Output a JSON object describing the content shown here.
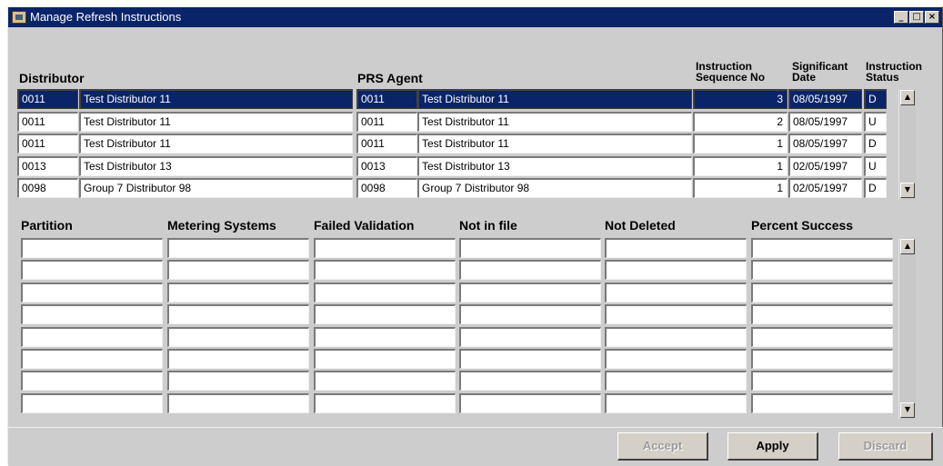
{
  "window": {
    "title": "Manage Refresh Instructions",
    "minimize_glyph": "_",
    "maximize_glyph": "□",
    "close_glyph": "×"
  },
  "instructions": {
    "headers": {
      "distributor": "Distributor",
      "prs_agent": "PRS Agent",
      "sequence_line1": "Instruction",
      "sequence_line2": "Sequence No",
      "date_line1": "Significant",
      "date_line2": "Date",
      "status_line1": "Instruction",
      "status_line2": "Status"
    },
    "rows": [
      {
        "dist_id": "0011",
        "dist_name": "Test Distributor 11",
        "agent_id": "0011",
        "agent_name": "Test Distributor 11",
        "seq": "3",
        "date": "08/05/1997",
        "status": "D",
        "selected": true
      },
      {
        "dist_id": "0011",
        "dist_name": "Test Distributor 11",
        "agent_id": "0011",
        "agent_name": "Test Distributor 11",
        "seq": "2",
        "date": "08/05/1997",
        "status": "U",
        "selected": false
      },
      {
        "dist_id": "0011",
        "dist_name": "Test Distributor 11",
        "agent_id": "0011",
        "agent_name": "Test Distributor 11",
        "seq": "1",
        "date": "08/05/1997",
        "status": "D",
        "selected": false
      },
      {
        "dist_id": "0013",
        "dist_name": "Test Distributor 13",
        "agent_id": "0013",
        "agent_name": "Test Distributor 13",
        "seq": "1",
        "date": "02/05/1997",
        "status": "U",
        "selected": false
      },
      {
        "dist_id": "0098",
        "dist_name": "Group 7 Distributor 98",
        "agent_id": "0098",
        "agent_name": "Group 7 Distributor 98",
        "seq": "1",
        "date": "02/05/1997",
        "status": "D",
        "selected": false
      }
    ]
  },
  "results": {
    "headers": {
      "partition": "Partition",
      "metering": "Metering Systems",
      "failed": "Failed Validation",
      "not_in_file": "Not in file",
      "not_deleted": "Not Deleted",
      "percent": "Percent Success"
    },
    "row_count": 8
  },
  "scrollbar": {
    "up_glyph": "▲",
    "down_glyph": "▼"
  },
  "buttons": {
    "accept": "Accept",
    "apply": "Apply",
    "discard": "Discard"
  },
  "colors": {
    "title_bar": "#0a246a",
    "selection": "#0a246a",
    "window_bg": "#cdcdcd"
  }
}
